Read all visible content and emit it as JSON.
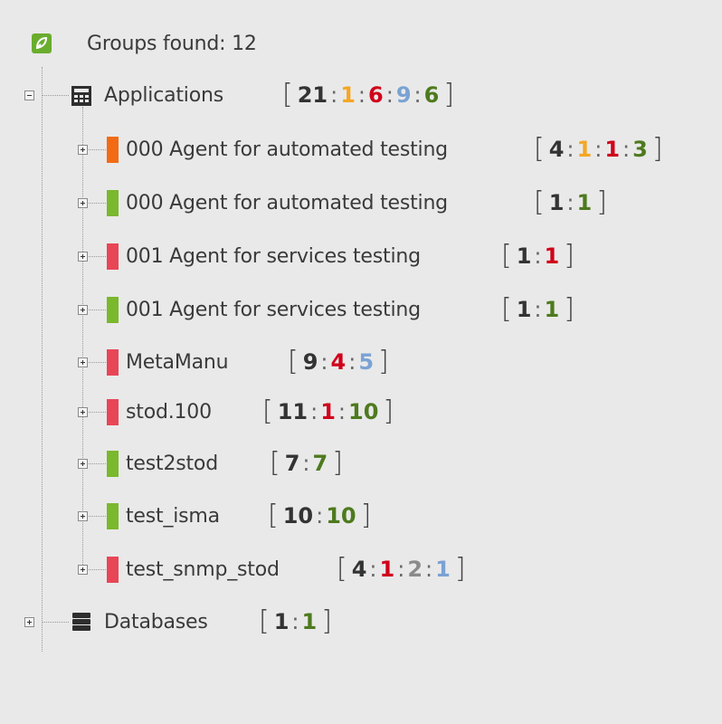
{
  "header": {
    "text": "Groups found: 12"
  },
  "colors": {
    "orange": "#f26b14",
    "green": "#7ab82d",
    "red": "#e84656",
    "logo": "#6aad2e"
  },
  "root_nodes": [
    {
      "label": "Applications",
      "icon": "calculator-icon",
      "expanded": true,
      "counts": [
        {
          "value": "21",
          "color": "total"
        },
        {
          "value": "1",
          "color": "orange"
        },
        {
          "value": "6",
          "color": "red"
        },
        {
          "value": "9",
          "color": "blue"
        },
        {
          "value": "6",
          "color": "green"
        }
      ],
      "children": [
        {
          "label": "000 Agent for automated testing",
          "status": "orange",
          "counts": [
            {
              "value": "4",
              "color": "total"
            },
            {
              "value": "1",
              "color": "orange"
            },
            {
              "value": "1",
              "color": "red"
            },
            {
              "value": "3",
              "color": "green"
            }
          ]
        },
        {
          "label": "000 Agent for automated testing",
          "status": "green",
          "counts": [
            {
              "value": "1",
              "color": "total"
            },
            {
              "value": "1",
              "color": "green"
            }
          ]
        },
        {
          "label": "001 Agent for services testing",
          "status": "red",
          "counts": [
            {
              "value": "1",
              "color": "total"
            },
            {
              "value": "1",
              "color": "red"
            }
          ]
        },
        {
          "label": "001 Agent for services testing",
          "status": "green",
          "counts": [
            {
              "value": "1",
              "color": "total"
            },
            {
              "value": "1",
              "color": "green"
            }
          ]
        },
        {
          "label": "MetaManu",
          "status": "red",
          "counts": [
            {
              "value": "9",
              "color": "total"
            },
            {
              "value": "4",
              "color": "red"
            },
            {
              "value": "5",
              "color": "blue"
            }
          ]
        },
        {
          "label": "stod.100",
          "status": "red",
          "counts": [
            {
              "value": "11",
              "color": "total"
            },
            {
              "value": "1",
              "color": "red"
            },
            {
              "value": "10",
              "color": "green"
            }
          ]
        },
        {
          "label": "test2stod",
          "status": "green",
          "counts": [
            {
              "value": "7",
              "color": "total"
            },
            {
              "value": "7",
              "color": "green"
            }
          ]
        },
        {
          "label": "test_isma",
          "status": "green",
          "counts": [
            {
              "value": "10",
              "color": "total"
            },
            {
              "value": "10",
              "color": "green"
            }
          ]
        },
        {
          "label": "test_snmp_stod",
          "status": "red",
          "counts": [
            {
              "value": "4",
              "color": "total"
            },
            {
              "value": "1",
              "color": "red"
            },
            {
              "value": "2",
              "color": "gray"
            },
            {
              "value": "1",
              "color": "blue"
            }
          ]
        }
      ]
    },
    {
      "label": "Databases",
      "icon": "database-icon",
      "expanded": false,
      "counts": [
        {
          "value": "1",
          "color": "total"
        },
        {
          "value": "1",
          "color": "green"
        }
      ]
    }
  ]
}
